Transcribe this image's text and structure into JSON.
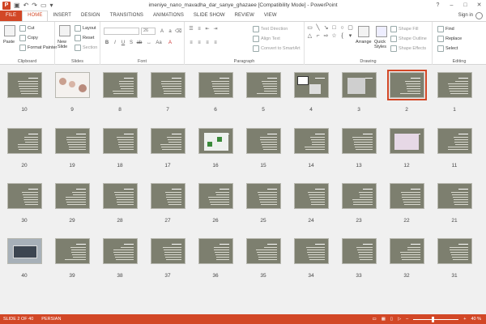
{
  "window": {
    "title": "imeniye_nano_mavadha_dar_sanye_ghazaee [Compatibility Mode] - PowerPoint",
    "app_letter": "P",
    "controls": [
      "?",
      "–",
      "□",
      "✕"
    ]
  },
  "tabs": [
    "FILE",
    "HOME",
    "INSERT",
    "DESIGN",
    "TRANSITIONS",
    "ANIMATIONS",
    "SLIDE SHOW",
    "REVIEW",
    "VIEW"
  ],
  "active_tab": "HOME",
  "signin": "Sign in",
  "ribbon": {
    "clipboard": {
      "label": "Clipboard",
      "paste": "Paste",
      "cut": "Cut",
      "copy": "Copy",
      "format_painter": "Format Painter"
    },
    "slides": {
      "label": "Slides",
      "new_slide": "New Slide",
      "layout": "Layout",
      "reset": "Reset",
      "section": "Section"
    },
    "font": {
      "label": "Font",
      "font_size": "26"
    },
    "paragraph": {
      "label": "Paragraph",
      "text_direction": "Text Direction",
      "align_text": "Align Text",
      "convert_smartart": "Convert to SmartArt"
    },
    "drawing": {
      "label": "Drawing",
      "arrange": "Arrange",
      "quick_styles": "Quick Styles",
      "shape_fill": "Shape Fill",
      "shape_outline": "Shape Outline",
      "shape_effects": "Shape Effects"
    },
    "editing": {
      "label": "Editing",
      "find": "Find",
      "replace": "Replace",
      "select": "Select"
    }
  },
  "slides": {
    "total": 40,
    "selected": 2,
    "numbers": [
      "1",
      "2",
      "3",
      "4",
      "5",
      "6",
      "7",
      "8",
      "9",
      "10",
      "11",
      "12",
      "13",
      "14",
      "15",
      "16",
      "17",
      "18",
      "19",
      "20",
      "21",
      "22",
      "23",
      "24",
      "25",
      "26",
      "27",
      "28",
      "29",
      "30",
      "31",
      "32",
      "33",
      "34",
      "35",
      "36",
      "37",
      "38",
      "39",
      "40"
    ]
  },
  "status": {
    "slide_info": "SLIDE 2 OF 40",
    "language": "PERSIAN",
    "zoom": "40 %",
    "zoom_level_fraction": 0.4
  },
  "colors": {
    "accent": "#d24726",
    "slide_bg": "#7d7f6f"
  }
}
